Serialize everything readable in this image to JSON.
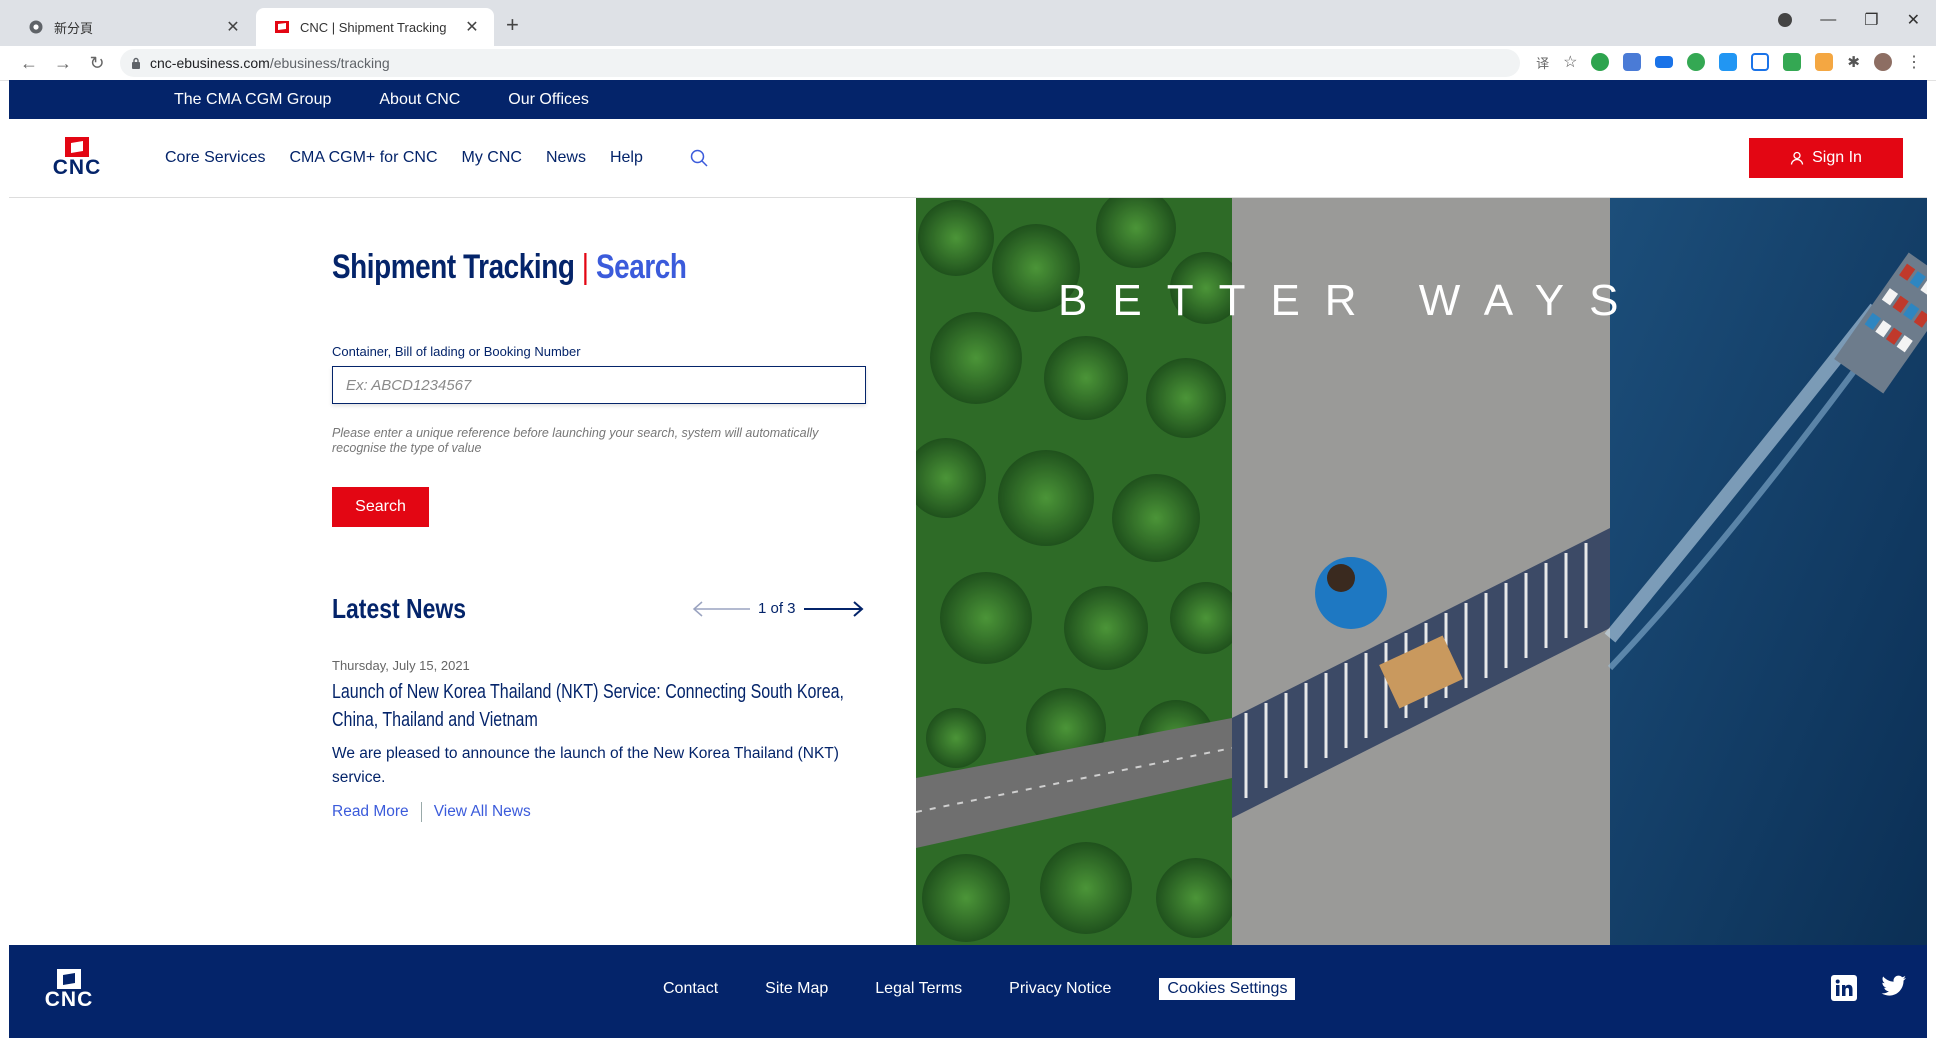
{
  "browser": {
    "tabs": [
      {
        "title": "新分頁",
        "active": false
      },
      {
        "title": "CNC | Shipment Tracking",
        "active": true
      }
    ],
    "url_host": "cnc-ebusiness.com",
    "url_path": "/ebusiness/tracking"
  },
  "topbar": {
    "links": [
      "The CMA CGM Group",
      "About CNC",
      "Our Offices"
    ]
  },
  "header": {
    "logo_text": "CNC",
    "nav": [
      "Core Services",
      "CMA CGM+ for CNC",
      "My CNC",
      "News",
      "Help"
    ],
    "signin_label": "Sign In"
  },
  "tracking": {
    "title": "Shipment Tracking",
    "title_sep": "|",
    "title_sub": "Search",
    "field_label": "Container, Bill of lading or Booking Number",
    "placeholder": "Ex: ABCD1234567",
    "hint": "Please enter a unique reference before launching your search, system will automatically recognise the type of value",
    "search_label": "Search"
  },
  "news": {
    "title": "Latest News",
    "pager": "1 of 3",
    "date": "Thursday, July 15, 2021",
    "headline": "Launch of New Korea Thailand (NKT) Service: Connecting South Korea, China, Thailand and Vietnam",
    "body": "We are pleased to announce the launch of the New Korea Thailand (NKT) service.",
    "read_more": "Read More",
    "view_all": "View All News"
  },
  "hero": {
    "text": "BETTER WAYS"
  },
  "footer": {
    "logo_text": "CNC",
    "links": [
      "Contact",
      "Site Map",
      "Legal Terms",
      "Privacy Notice"
    ],
    "cookies_label": "Cookies Settings"
  },
  "colors": {
    "brand_navy": "#04246a",
    "brand_red": "#e30613",
    "link_blue": "#3b5bdb"
  }
}
